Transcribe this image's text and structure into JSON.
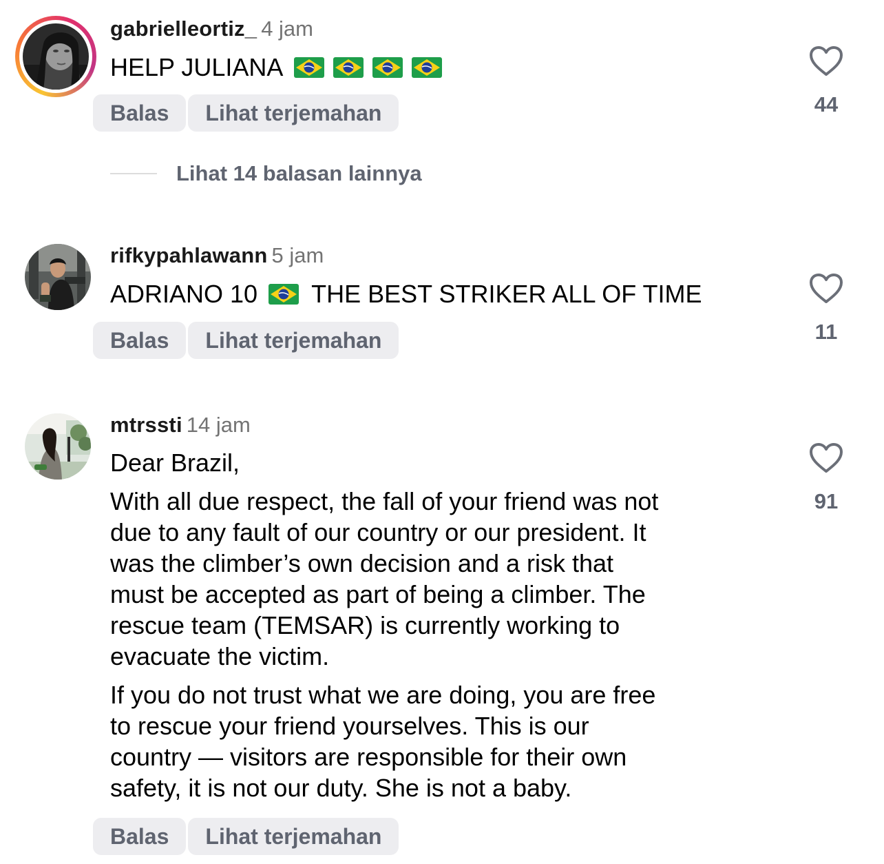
{
  "comments": [
    {
      "username": "gabrielleortiz_",
      "time": "4 jam",
      "text": "HELP JULIANA",
      "flag_count": 4,
      "likes": "44",
      "reply_label": "Balas",
      "translate_label": "Lihat terjemahan",
      "view_replies": "Lihat 14 balasan lainnya",
      "has_story": true
    },
    {
      "username": "rifkypahlawann",
      "time": "5 jam",
      "text_before_flag": "ADRIANO 10",
      "text_after_flag": "THE BEST STRIKER ALL OF TIME",
      "likes": "11",
      "reply_label": "Balas",
      "translate_label": "Lihat terjemahan"
    },
    {
      "username": "mtrssti",
      "time": "14 jam",
      "paragraphs": [
        [
          "Dear Brazil,"
        ],
        [
          "With all due respect, the fall of your friend was not",
          "due to any fault of our country or our president. It",
          "was the climber’s own decision and a risk that",
          "must be accepted as part of being a climber. The",
          "rescue team (TEMSAR) is currently working to",
          "evacuate the victim."
        ],
        [
          "If you do not trust what we are doing, you are free",
          "to rescue your friend yourselves. This is our",
          "country — visitors are responsible for their own",
          "safety, it is not our duty. She is not a baby."
        ]
      ],
      "likes": "91",
      "reply_label": "Balas",
      "translate_label": "Lihat terjemahan"
    }
  ],
  "icons": {
    "like": "heart-outline-icon",
    "flag": "brazil-flag-icon"
  },
  "colors": {
    "secondary_text": "#737373",
    "pill_background": "#ededf0",
    "pill_text": "#5f6470",
    "story_ring": [
      "#f9c433",
      "#f77737",
      "#e1306c",
      "#c13584"
    ]
  }
}
